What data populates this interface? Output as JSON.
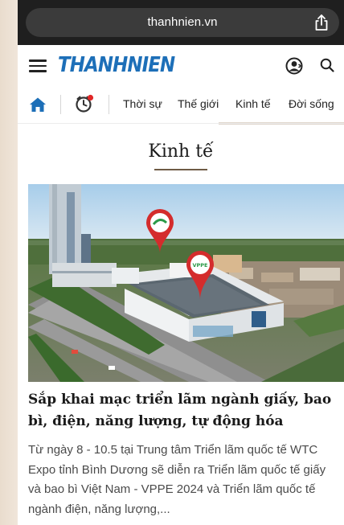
{
  "browser": {
    "url": "thanhnien.vn"
  },
  "header": {
    "logo_text": "THANHNIEN"
  },
  "nav": {
    "items": [
      {
        "label": "Thời sự"
      },
      {
        "label": "Thế giới"
      },
      {
        "label": "Kinh tế"
      },
      {
        "label": "Đời sống"
      }
    ]
  },
  "section": {
    "title": "Kinh tế"
  },
  "article": {
    "image_sign": "VPPE",
    "title": "Sắp khai mạc triển lãm ngành giấy, bao bì, điện, năng lượng, tự động hóa",
    "summary": "Từ ngày 8 - 10.5 tại Trung tâm Triển lãm quốc tế WTC Expo tỉnh Bình Dương sẽ diễn ra Triển lãm quốc tế giấy và bao bì Việt Nam - VPPE 2024 và Triển lãm quốc tế ngành điện, năng lượng,..."
  },
  "colors": {
    "brand_blue": "#1d6fb8",
    "pin_red": "#d42c2c",
    "section_underline": "#6f5b45"
  }
}
